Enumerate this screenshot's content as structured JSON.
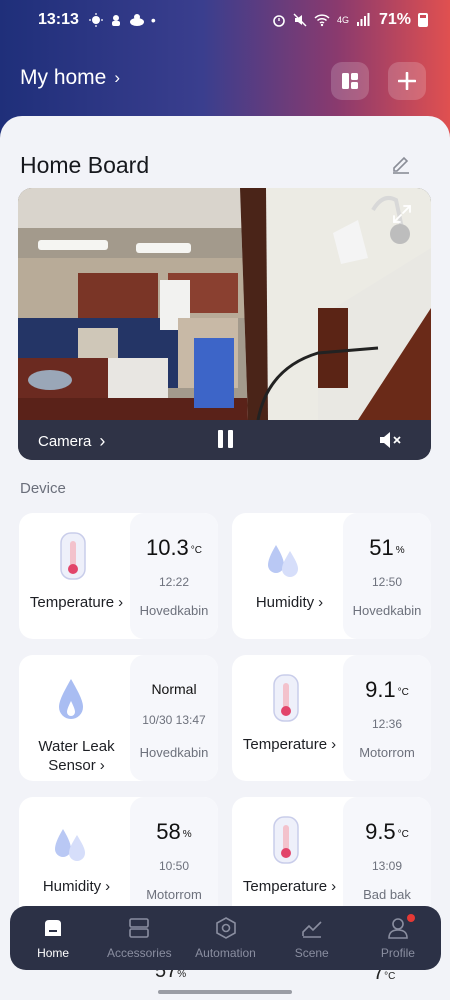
{
  "status_bar": {
    "time": "13:13",
    "battery": "71%",
    "network": "4G"
  },
  "header": {
    "home_name": "My home",
    "chevron": "›"
  },
  "board": {
    "title": "Home Board"
  },
  "camera": {
    "label": "Camera",
    "chevron": "›"
  },
  "devices_section": {
    "label": "Device"
  },
  "devices": [
    {
      "name": "Temperature",
      "value": "10.3",
      "unit": "°C",
      "time": "12:22",
      "location": "Hovedkabin",
      "icon": "thermometer-icon"
    },
    {
      "name": "Humidity",
      "value": "51",
      "unit": "%",
      "time": "12:50",
      "location": "Hovedkabin",
      "icon": "humidity-icon"
    },
    {
      "name": "Water Leak Sensor",
      "value": "Normal",
      "unit": "",
      "time": "10/30 13:47",
      "location": "Hovedkabin",
      "icon": "water-drop-icon"
    },
    {
      "name": "Temperature",
      "value": "9.1",
      "unit": "°C",
      "time": "12:36",
      "location": "Motorrom",
      "icon": "thermometer-icon"
    },
    {
      "name": "Humidity",
      "value": "58",
      "unit": "%",
      "time": "10:50",
      "location": "Motorrom",
      "icon": "humidity-icon"
    },
    {
      "name": "Temperature",
      "value": "9.5",
      "unit": "°C",
      "time": "13:09",
      "location": "Bad bak",
      "icon": "thermometer-icon"
    }
  ],
  "peek_values": [
    "57",
    "7"
  ],
  "peek_units": [
    "%",
    "°C"
  ],
  "nav": {
    "items": [
      {
        "label": "Home",
        "icon": "home-icon",
        "active": true
      },
      {
        "label": "Accessories",
        "icon": "accessories-icon",
        "active": false
      },
      {
        "label": "Automation",
        "icon": "automation-icon",
        "active": false
      },
      {
        "label": "Scene",
        "icon": "scene-icon",
        "active": false
      },
      {
        "label": "Profile",
        "icon": "profile-icon",
        "active": false
      }
    ]
  },
  "colors": {
    "nav_bg": "#2c3146",
    "accent_red": "#e53935",
    "thermo_red": "#e2456a",
    "drop_blue": "#6f8fe8"
  }
}
